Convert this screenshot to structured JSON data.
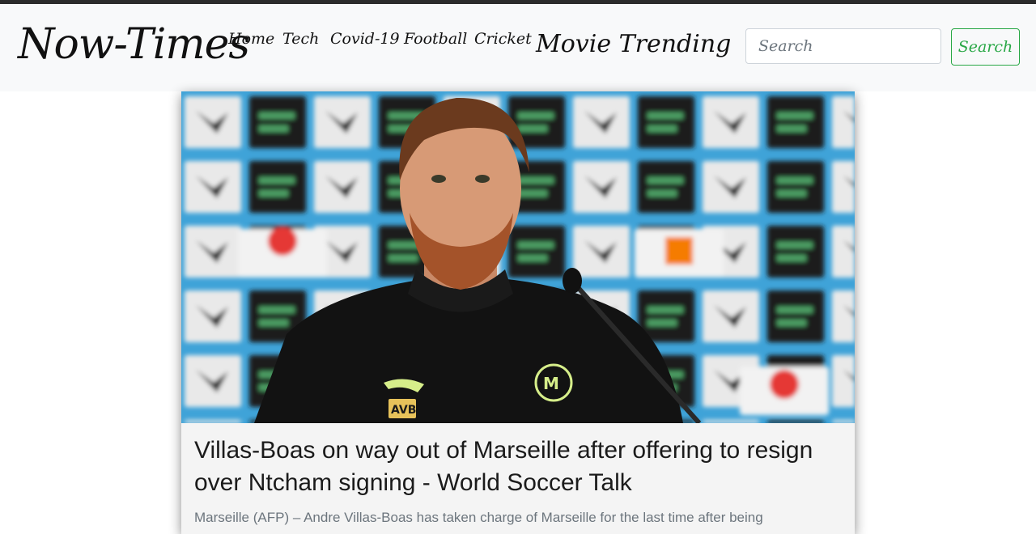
{
  "navbar": {
    "brand": "Now-Times",
    "links": [
      {
        "label": "Home"
      },
      {
        "label": "Tech"
      },
      {
        "label": "Covid-19"
      },
      {
        "label": "Football"
      },
      {
        "label": "Cricket"
      },
      {
        "label": "Movie Trending"
      }
    ],
    "search": {
      "placeholder": "Search",
      "value": "",
      "button_label": "Search"
    }
  },
  "article": {
    "title": "Villas-Boas on way out of Marseille after offering to resign over Ntcham signing - World Soccer Talk",
    "description": "Marseille (AFP) – Andre Villas-Boas has taken charge of Marseille for the last time after being"
  },
  "colors": {
    "topbar": "#2b2b2b",
    "navbar_bg": "#f8f9fa",
    "search_accent": "#28a745",
    "card_bg": "#f4f4f4",
    "photo_backdrop": "#3fa3d8"
  },
  "photo": {
    "shirt_initials": "AVB",
    "subject": "coach at press conference"
  }
}
